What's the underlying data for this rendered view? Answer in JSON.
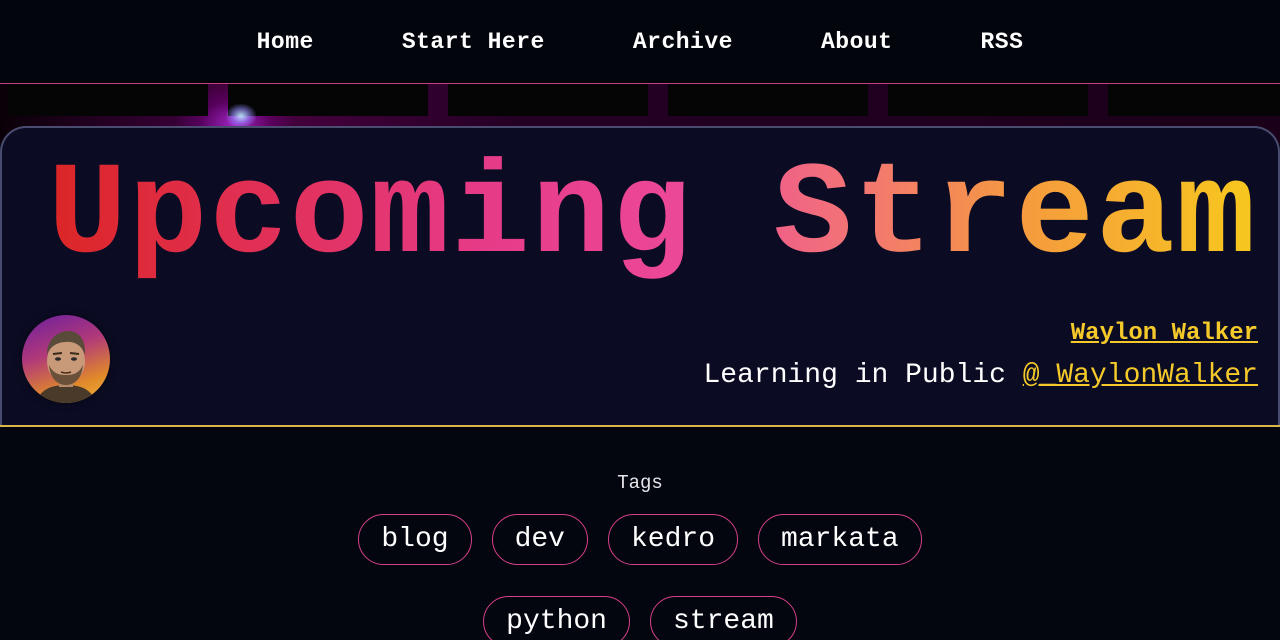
{
  "nav": {
    "items": [
      {
        "label": "Home"
      },
      {
        "label": "Start Here"
      },
      {
        "label": "Archive"
      },
      {
        "label": "About"
      },
      {
        "label": "RSS"
      }
    ]
  },
  "hero": {
    "title": "Upcoming Stream",
    "author_name": "Waylon Walker",
    "tagline_prefix": "Learning in Public ",
    "handle": "@_WaylonWalker"
  },
  "tags": {
    "label": "Tags",
    "row1": [
      "blog",
      "dev",
      "kedro",
      "markata"
    ],
    "row2": [
      "python",
      "stream"
    ]
  },
  "colors": {
    "accent_pink": "#d6408a",
    "accent_gold": "#f5c92a",
    "title_gradient": [
      "#dc2626",
      "#ec4899",
      "#f7c81d"
    ],
    "background": "#03060f",
    "card": "#0b0c24"
  }
}
